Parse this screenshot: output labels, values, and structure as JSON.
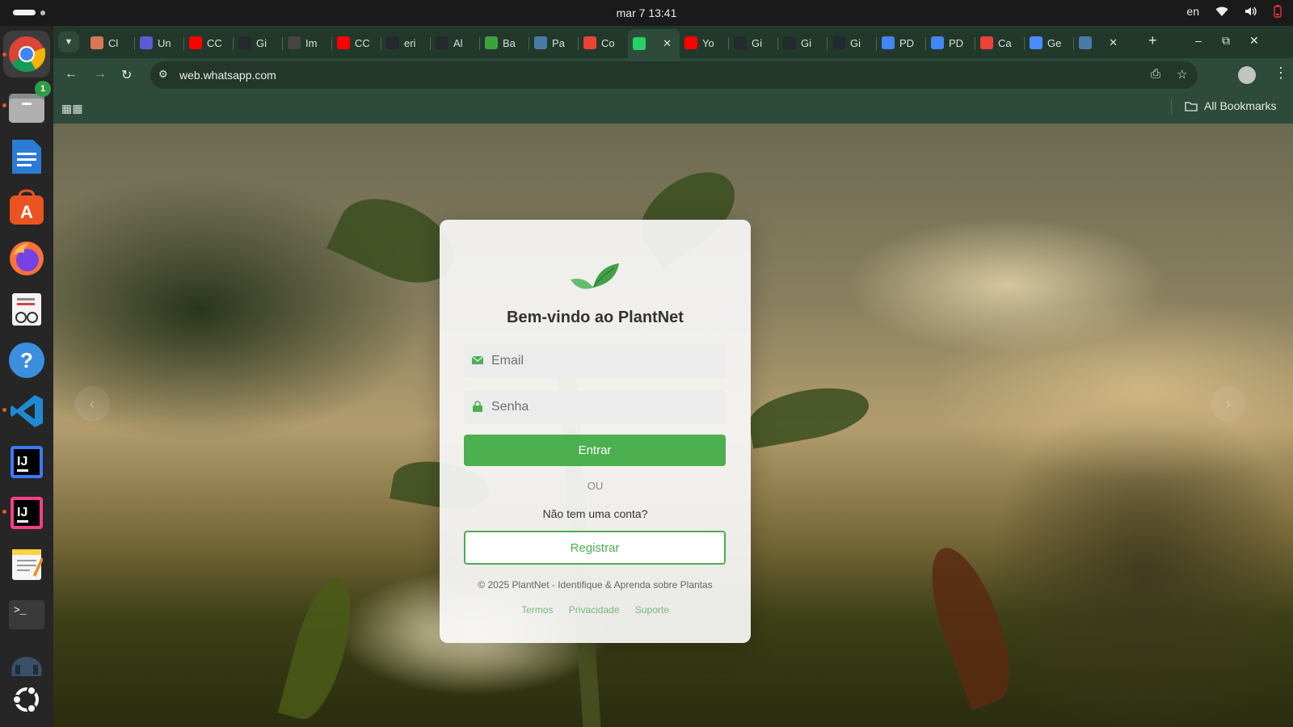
{
  "system": {
    "clock": "mar 7  13:41",
    "keyboard_layout": "en"
  },
  "dock": {
    "files_badge": "1",
    "apps": [
      "chrome-icon",
      "files-icon",
      "writer-icon",
      "app-center-icon",
      "firefox-icon",
      "document-viewer-icon",
      "help-icon",
      "vscode-icon",
      "intellij-ce-icon",
      "intellij-ultimate-icon",
      "text-editor-icon",
      "terminal-icon",
      "storage-icon",
      "ubuntu-icon"
    ]
  },
  "browser": {
    "tabs": [
      {
        "label": "Cl",
        "icon": "claude-icon",
        "color": "#d97757"
      },
      {
        "label": "Un",
        "icon": "udemy-icon",
        "color": "#5b5bd6"
      },
      {
        "label": "CC",
        "icon": "youtube-icon",
        "color": "#ff0000"
      },
      {
        "label": "Gi",
        "icon": "github-icon",
        "color": "#24292f"
      },
      {
        "label": "Im",
        "icon": "openai-icon",
        "color": "#444444"
      },
      {
        "label": "CC",
        "icon": "youtube-icon",
        "color": "#ff0000"
      },
      {
        "label": "eri",
        "icon": "github-icon",
        "color": "#24292f"
      },
      {
        "label": "Al",
        "icon": "github-icon",
        "color": "#24292f"
      },
      {
        "label": "Ba",
        "icon": "download-icon",
        "color": "#3ca33c"
      },
      {
        "label": "Pa",
        "icon": "lens-icon",
        "color": "#4a7aa8"
      },
      {
        "label": "Co",
        "icon": "gmail-icon",
        "color": "#ea4335"
      },
      {
        "label": "",
        "icon": "whatsapp-icon",
        "color": "#25d366",
        "active": true
      },
      {
        "label": "Yo",
        "icon": "youtube-icon",
        "color": "#ff0000"
      },
      {
        "label": "Gi",
        "icon": "github-icon",
        "color": "#24292f"
      },
      {
        "label": "Gi",
        "icon": "github-icon",
        "color": "#24292f"
      },
      {
        "label": "Gi",
        "icon": "github-icon",
        "color": "#24292f"
      },
      {
        "label": "PD",
        "icon": "docs-icon",
        "color": "#4285f4"
      },
      {
        "label": "PD",
        "icon": "docs-icon",
        "color": "#4285f4"
      },
      {
        "label": "Ca",
        "icon": "gmail-icon",
        "color": "#ea4335"
      },
      {
        "label": "Ge",
        "icon": "gemini-icon",
        "color": "#4a8cff"
      },
      {
        "label": "",
        "icon": "lens-icon",
        "color": "#4a7aa8"
      }
    ],
    "url": "web.whatsapp.com",
    "all_bookmarks": "All Bookmarks"
  },
  "login": {
    "title": "Bem-vindo ao PlantNet",
    "email_placeholder": "Email",
    "password_placeholder": "Senha",
    "submit_label": "Entrar",
    "or_label": "OU",
    "no_account": "Não tem uma conta?",
    "register_label": "Registrar",
    "copyright": "© 2025 PlantNet - Identifique & Aprenda sobre Plantas",
    "footer_links": [
      "Termos",
      "Privacidade",
      "Suporte"
    ],
    "accent_color": "#4caf50"
  }
}
